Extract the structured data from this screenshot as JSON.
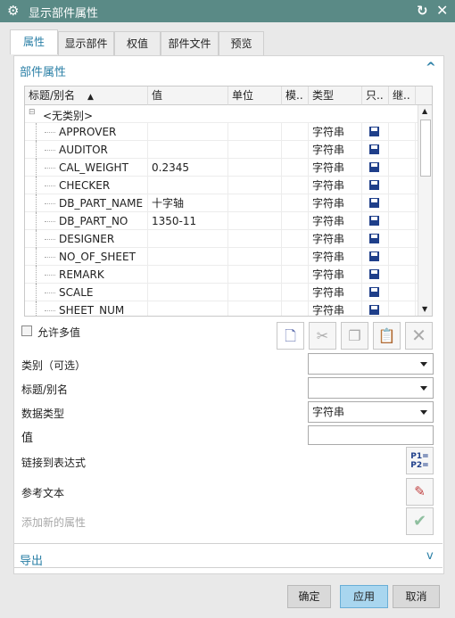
{
  "window": {
    "title": "显示部件属性",
    "icon": "gear-icon",
    "reset_icon": "reset-icon",
    "close_icon": "close-icon"
  },
  "tabs": [
    {
      "label": "属性",
      "active": true
    },
    {
      "label": "显示部件"
    },
    {
      "label": "权值"
    },
    {
      "label": "部件文件"
    },
    {
      "label": "预览"
    }
  ],
  "section_attributes": {
    "title": "部件属性",
    "collapse_icon": "chevron-up-icon"
  },
  "table": {
    "columns": [
      "标题/别名",
      "值",
      "单位",
      "模..",
      "类型",
      "只..",
      "继.."
    ],
    "sort_icon": "sort-ascending-icon",
    "group": "<无类别>",
    "rows": [
      {
        "title": "APPROVER",
        "value": "",
        "type": "字符串"
      },
      {
        "title": "AUDITOR",
        "value": "",
        "type": "字符串"
      },
      {
        "title": "CAL_WEIGHT",
        "value": "0.2345",
        "type": "字符串"
      },
      {
        "title": "CHECKER",
        "value": "",
        "type": "字符串"
      },
      {
        "title": "DB_PART_NAME",
        "value": "十字轴",
        "type": "字符串"
      },
      {
        "title": "DB_PART_NO",
        "value": "1350-11",
        "type": "字符串"
      },
      {
        "title": "DESIGNER",
        "value": "",
        "type": "字符串"
      },
      {
        "title": "NO_OF_SHEET",
        "value": "",
        "type": "字符串"
      },
      {
        "title": "REMARK",
        "value": "",
        "type": "字符串"
      },
      {
        "title": "SCALE",
        "value": "",
        "type": "字符串"
      },
      {
        "title": "SHEET_NUM",
        "value": "",
        "type": "字符串"
      }
    ]
  },
  "allow_multiple": {
    "label": "允许多值",
    "checked": false
  },
  "toolbar": [
    "new-icon",
    "cut-icon",
    "copy-icon",
    "paste-icon",
    "delete-icon"
  ],
  "form": {
    "category": {
      "label": "类别（可选）",
      "value": ""
    },
    "title": {
      "label": "标题/别名",
      "value": ""
    },
    "data_type": {
      "label": "数据类型",
      "value": "字符串"
    },
    "value": {
      "label": "值",
      "value": ""
    },
    "link_expr": {
      "label": "链接到表达式"
    },
    "ref_text": {
      "label": "参考文本"
    },
    "add_new": {
      "label": "添加新的属性"
    }
  },
  "section_export": {
    "title": "导出",
    "expand_icon": "chevron-down-icon"
  },
  "buttons": {
    "ok": "确定",
    "apply": "应用",
    "cancel": "取消"
  },
  "colors": {
    "titlebar": "#5a8a86",
    "accent": "#2a7fa6",
    "apply": "#a9d6ef"
  }
}
